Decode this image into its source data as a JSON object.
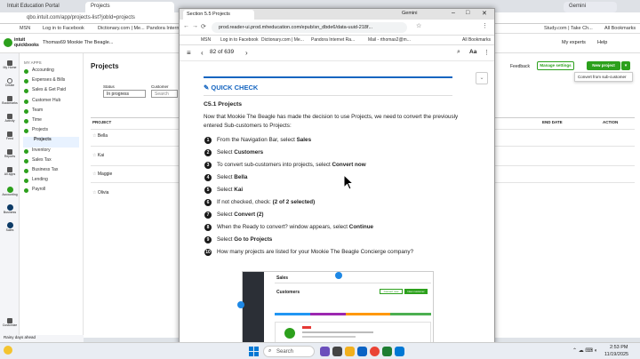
{
  "bg_browser": {
    "tabs": [
      {
        "label": "Intuit Education Portal"
      },
      {
        "label": "Projects",
        "active": true
      },
      {
        "label": "Gemini"
      }
    ],
    "address": "qbo.intuit.com/app/projects-list?jobId=projects",
    "bookmarks": [
      "MSN",
      "Log in to Facebook",
      "Dictionary.com | Me...",
      "Pandora Internet Ra...",
      "Study.com | Take Ch...",
      "All Bookmarks"
    ]
  },
  "qb": {
    "logo_line1": "intuit",
    "logo_line2": "quickbooks",
    "company": "Thomas69 Mookie The Beagle...",
    "top_right": [
      "My experts",
      "Help"
    ],
    "side_icons": [
      {
        "label": "My Home",
        "icon": "home-icon"
      },
      {
        "label": "Create",
        "icon": "plus-icon"
      },
      {
        "label": "Bookmarks",
        "icon": "bookmark-icon"
      },
      {
        "label": "Activity",
        "icon": "activity-icon"
      },
      {
        "label": "Feed",
        "icon": "feed-icon"
      },
      {
        "label": "Reports",
        "icon": "reports-icon"
      },
      {
        "label": "All apps",
        "icon": "apps-icon"
      },
      {
        "label": "Accounting",
        "icon": "accounting-icon"
      },
      {
        "label": "Business",
        "icon": "business-icon"
      },
      {
        "label": "Sales",
        "icon": "sales-icon"
      },
      {
        "label": "Customize",
        "icon": "customize-icon"
      }
    ],
    "menu_header": "MY APPS",
    "menu": [
      "Accounting",
      "Expenses & Bills",
      "Sales & Get Paid",
      "Customer Hub",
      "Team",
      "Time",
      "Projects",
      "Projects",
      "Inventory",
      "Sales Tax",
      "Business Tax",
      "Lending",
      "Payroll"
    ],
    "page_title": "Projects",
    "filters": {
      "status_label": "Status",
      "status_value": "In progress",
      "customer_label": "Customer",
      "customer_placeholder": "Search"
    },
    "actions": {
      "feedback": "Feedback",
      "manage": "Manage settings",
      "new_project": "New project",
      "convert": "Convert from sub-customer"
    },
    "table": {
      "headers": [
        "PROJECT",
        "END DATE",
        "ACTION"
      ],
      "rows": [
        "Bella",
        "Kai",
        "Maggie",
        "Olivia"
      ]
    },
    "weather": {
      "line1": "Rainy days ahead",
      "line2": "63°F"
    }
  },
  "win": {
    "tab_label": "Section 5.5 Projects",
    "tab_right": "Gemini",
    "address": "prod.reader-ui.prod.mheducation.com/epub/sn_dbde6/data-uuid-218f...",
    "bookmarks": [
      "MSN",
      "Log in to Facebook",
      "Dictionary.com | Me...",
      "Pandora Internet Ra...",
      "Mail - rthomas2@m...",
      "All Bookmarks"
    ],
    "page_indicator": "82 of 639",
    "quick_check": "QUICK CHECK",
    "section": "C5.1 Projects",
    "intro": "Now that Mookie The Beagle has made the decision to use Projects, we need to convert the previously entered Sub-customers to Projects:",
    "steps": [
      {
        "n": "1",
        "pre": "From the Navigation Bar, select ",
        "bold": "Sales",
        "post": ""
      },
      {
        "n": "2",
        "pre": "Select ",
        "bold": "Customers",
        "post": ""
      },
      {
        "n": "3",
        "pre": "To convert sub-customers into projects, select ",
        "bold": "Convert now",
        "post": ""
      },
      {
        "n": "4",
        "pre": "Select ",
        "bold": "Bella",
        "post": ""
      },
      {
        "n": "5",
        "pre": "Select ",
        "bold": "Kai",
        "post": ""
      },
      {
        "n": "6",
        "pre": "If not checked, check: ",
        "bold": "(2 of 2 selected)",
        "post": ""
      },
      {
        "n": "7",
        "pre": "Select ",
        "bold": "Convert (2)",
        "post": ""
      },
      {
        "n": "8",
        "pre": "When the Ready to convert? window appears, select ",
        "bold": "Continue",
        "post": ""
      },
      {
        "n": "9",
        "pre": "Select ",
        "bold": "Go to Projects",
        "post": ""
      },
      {
        "n": "10",
        "pre": "How many projects are listed for your Mookie The Beagle Concierge company?",
        "bold": "",
        "post": ""
      }
    ],
    "figure": {
      "app_title": "Sales",
      "page_title": "Customers",
      "btn1": "Convert now",
      "btn2": "New customer"
    }
  },
  "taskbar": {
    "search": "Search",
    "time": "2:53 PM",
    "date": "11/19/2025"
  }
}
